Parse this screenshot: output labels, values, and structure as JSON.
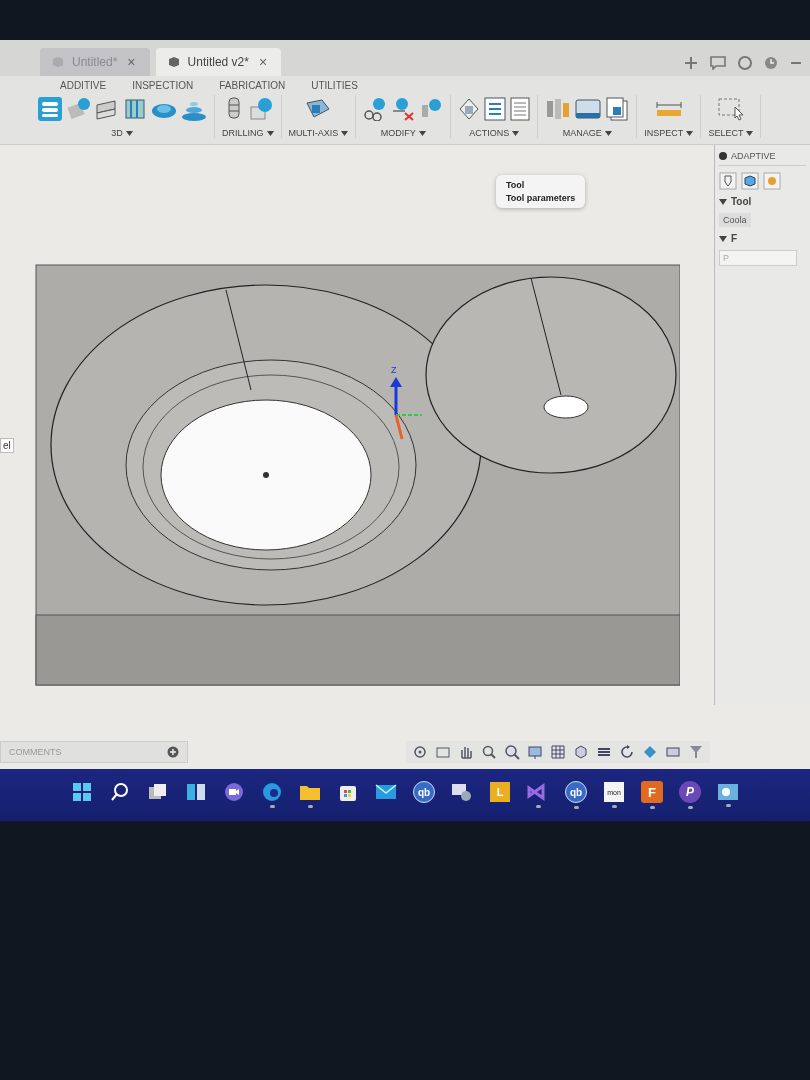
{
  "document_tabs": [
    {
      "label": "Untitled*",
      "selected": false,
      "close": "×"
    },
    {
      "label": "Untitled v2*",
      "selected": true,
      "close": "×"
    }
  ],
  "workspace_tabs": [
    {
      "label": "ADDITIVE"
    },
    {
      "label": "INSPECTION"
    },
    {
      "label": "FABRICATION"
    },
    {
      "label": "UTILITIES"
    }
  ],
  "ribbon_groups": [
    {
      "label": "3D"
    },
    {
      "label": "DRILLING"
    },
    {
      "label": "MULTI-AXIS"
    },
    {
      "label": "MODIFY"
    },
    {
      "label": "ACTIONS"
    },
    {
      "label": "MANAGE"
    },
    {
      "label": "INSPECT"
    },
    {
      "label": "SELECT"
    }
  ],
  "browser_fragment": "el",
  "viewport": {
    "axis_label": "Z",
    "tooltip": [
      "Tool",
      "Tool parameters"
    ]
  },
  "side_panel": {
    "title": "ADAPTIVE",
    "tool_section": {
      "label": "Tool",
      "expanded": true
    },
    "subtab": "Coola",
    "section": {
      "label": "F",
      "expanded": true
    },
    "field_placeholder": "P"
  },
  "comments": {
    "label": "COMMENTS"
  },
  "taskbar": [
    {
      "kind": "start",
      "running": false
    },
    {
      "kind": "search",
      "running": false
    },
    {
      "kind": "taskview",
      "running": false
    },
    {
      "kind": "widgets",
      "running": false
    },
    {
      "kind": "chat",
      "running": false
    },
    {
      "kind": "edge",
      "running": true
    },
    {
      "kind": "explorer",
      "running": true
    },
    {
      "kind": "store",
      "running": false
    },
    {
      "kind": "mail",
      "running": false
    },
    {
      "kind": "letter",
      "glyph": "qb",
      "running": false
    },
    {
      "kind": "remote",
      "running": false
    },
    {
      "kind": "letter-square",
      "glyph": "L",
      "running": false
    },
    {
      "kind": "vs",
      "running": true
    },
    {
      "kind": "letter",
      "glyph": "qb",
      "running": true
    },
    {
      "kind": "letter-square",
      "glyph": "mon",
      "running": true
    },
    {
      "kind": "fusion",
      "glyph": "F",
      "running": true
    },
    {
      "kind": "letter",
      "glyph": "P",
      "running": true
    },
    {
      "kind": "scan",
      "running": true
    }
  ]
}
